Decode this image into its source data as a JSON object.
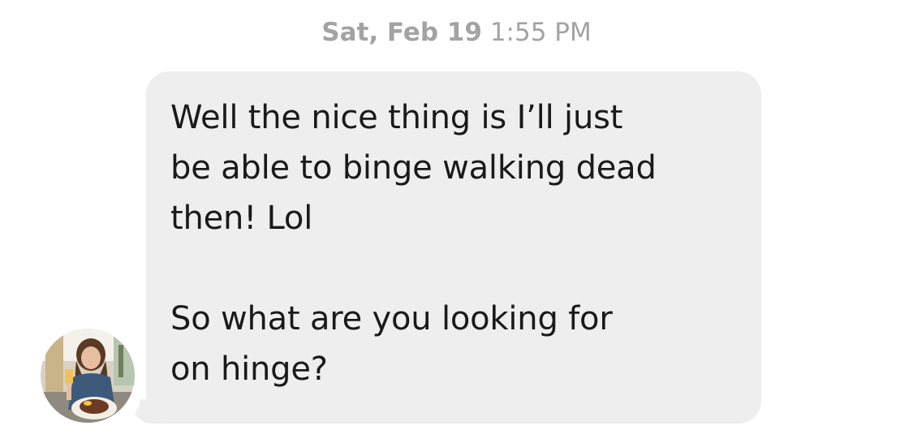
{
  "thread": {
    "timestamp": {
      "date": "Sat, Feb 19",
      "time": "1:55 PM"
    }
  },
  "message": {
    "text": "Well the nice thing is I’ll just\nbe able to binge walking dead\nthen! Lol\n\nSo what are you looking for\non hinge?"
  },
  "avatar": {
    "icon": "profile-photo"
  },
  "colors": {
    "bubble": "#eeeeee",
    "text": "#1a1a1a",
    "timestamp": "#a3a3a3",
    "background": "#ffffff"
  }
}
